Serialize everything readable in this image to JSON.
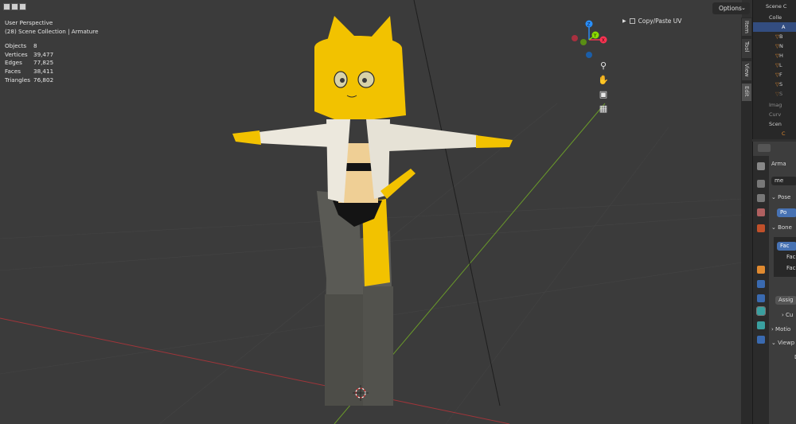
{
  "viewport": {
    "view_name": "User Perspective",
    "collection_path": "(28) Scene Collection | Armature",
    "stats": [
      {
        "label": "Objects",
        "value": "8"
      },
      {
        "label": "Vertices",
        "value": "39,477"
      },
      {
        "label": "Edges",
        "value": "77,825"
      },
      {
        "label": "Faces",
        "value": "38,411"
      },
      {
        "label": "Triangles",
        "value": "76,802"
      }
    ],
    "options_label": "Options",
    "copy_paste_label": "Copy/Paste UV",
    "gizmo": {
      "z": "Z",
      "y": "Y",
      "x": "X"
    }
  },
  "side_tabs": [
    "Item",
    "Tool",
    "View",
    "Edit"
  ],
  "outliner": {
    "items": [
      "Scene C",
      "Colle",
      "A",
      "B",
      "N",
      "H",
      "L",
      "F",
      "S",
      "S",
      "Imag",
      "Curv",
      "Scen",
      "C"
    ]
  },
  "properties": {
    "header": "Arma",
    "data_field": "me",
    "pose_label": "Pose",
    "pose_btn": "Po",
    "bone_label": "Bone",
    "bone_items": [
      "Fac",
      "Fac",
      "Fac"
    ],
    "assign_btn": "Assig",
    "cu_label": "Cu",
    "motion_label": "Motio",
    "viewport_label": "Viewp",
    "d_label": "D"
  },
  "colors": {
    "viewport_bg": "#3b3b3b",
    "accent": "#4772b3",
    "x_axis": "#ff3352",
    "y_axis": "#8bdc00",
    "z_axis": "#2890ff",
    "character_yellow": "#f2c200",
    "jacket": "#ece8dd",
    "pants": "#5a5a55"
  }
}
